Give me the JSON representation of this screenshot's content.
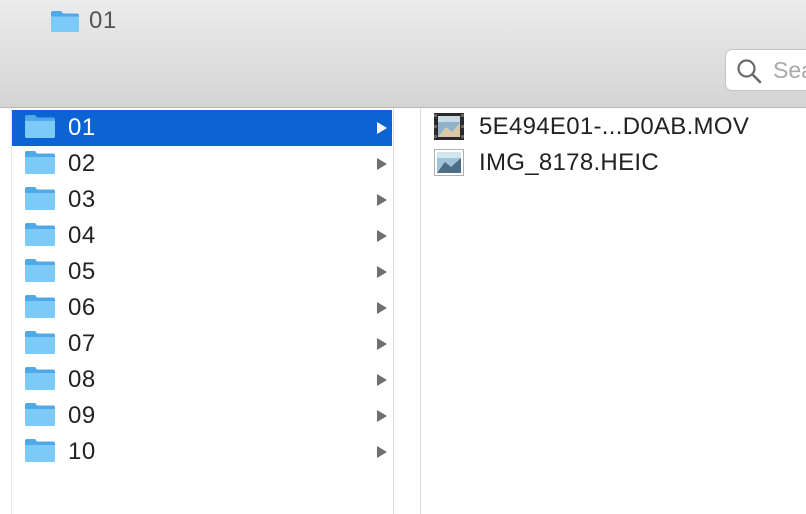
{
  "window": {
    "title": "01"
  },
  "search": {
    "placeholder": "Search"
  },
  "columns": {
    "folders": {
      "selected": "01",
      "items": [
        {
          "label": "01"
        },
        {
          "label": "02"
        },
        {
          "label": "03"
        },
        {
          "label": "04"
        },
        {
          "label": "05"
        },
        {
          "label": "06"
        },
        {
          "label": "07"
        },
        {
          "label": "08"
        },
        {
          "label": "09"
        },
        {
          "label": "10"
        }
      ]
    },
    "files": {
      "items": [
        {
          "label": "5E494E01-...D0AB.MOV",
          "kind": "video-thumbnail-icon"
        },
        {
          "label": "IMG_8178.HEIC",
          "kind": "image-thumbnail-icon"
        }
      ]
    }
  },
  "colors": {
    "selection": "#0c63d6",
    "folder_blue": "#6cc3f5",
    "toolbar_top": "#ececec",
    "toolbar_bottom": "#d4d4d4"
  },
  "icons": {
    "title": "folder-icon",
    "search": "magnifier-icon",
    "disclosure": "chevron-right-icon"
  }
}
